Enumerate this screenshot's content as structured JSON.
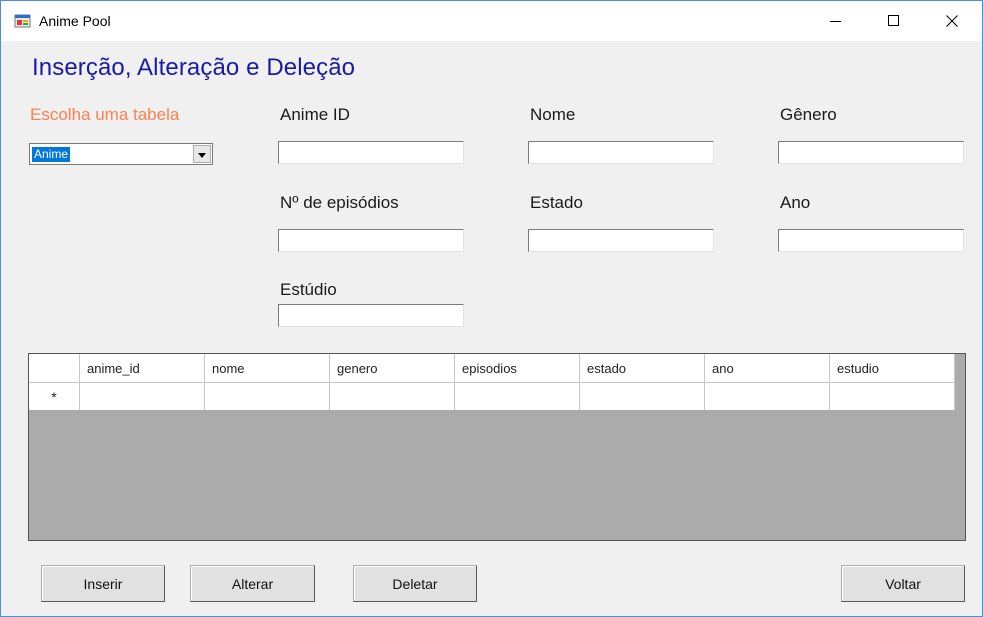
{
  "window": {
    "title": "Anime Pool",
    "controls": {
      "minimize": "minimize-icon",
      "maximize": "maximize-icon",
      "close": "close-icon"
    }
  },
  "form": {
    "heading": "Inserção, Alteração e Deleção",
    "table_selector": {
      "label": "Escolha uma tabela",
      "value": "Anime"
    },
    "fields": {
      "anime_id": "Anime ID",
      "nome": "Nome",
      "genero": "Gênero",
      "episodios": "Nº de episódios",
      "estado": "Estado",
      "ano": "Ano",
      "estudio": "Estúdio"
    }
  },
  "grid": {
    "columns": [
      "anime_id",
      "nome",
      "genero",
      "episodios",
      "estado",
      "ano",
      "estudio"
    ],
    "new_row_marker": "*"
  },
  "buttons": {
    "inserir": "Inserir",
    "alterar": "Alterar",
    "deletar": "Deletar",
    "voltar": "Voltar"
  },
  "colors": {
    "heading": "#1a1aa6",
    "orange_label": "#ff7f50",
    "grid_background": "#ababab",
    "selection": "#0078d7"
  }
}
